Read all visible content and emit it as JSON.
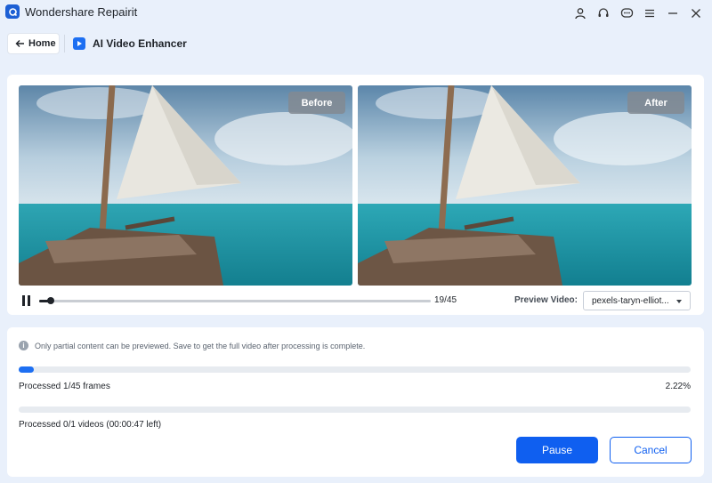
{
  "app": {
    "title": "Wondershare Repairit",
    "accent": "#0f5ff0"
  },
  "window_controls": [
    {
      "icon": "user-icon"
    },
    {
      "icon": "headset-icon"
    },
    {
      "icon": "chat-icon"
    },
    {
      "icon": "menu-icon"
    },
    {
      "icon": "minimize-icon"
    },
    {
      "icon": "close-icon"
    }
  ],
  "nav": {
    "home_label": "Home",
    "page_title": "AI Video Enhancer"
  },
  "preview": {
    "before_label": "Before",
    "after_label": "After",
    "frame_counter": "19/45",
    "playback_progress": 0.03,
    "preview_video_label": "Preview Video:",
    "preview_video_value": "pexels-taryn-elliot..."
  },
  "progress": {
    "info_text": "Only partial content can be previewed. Save to get the full video after processing is complete.",
    "frames_text": "Processed 1/45 frames",
    "frames_percent_text": "2.22%",
    "frames_fraction": 0.0222,
    "videos_text": "Processed 0/1 videos (00:00:47 left)",
    "videos_fraction": 0,
    "pause_label": "Pause",
    "cancel_label": "Cancel"
  }
}
